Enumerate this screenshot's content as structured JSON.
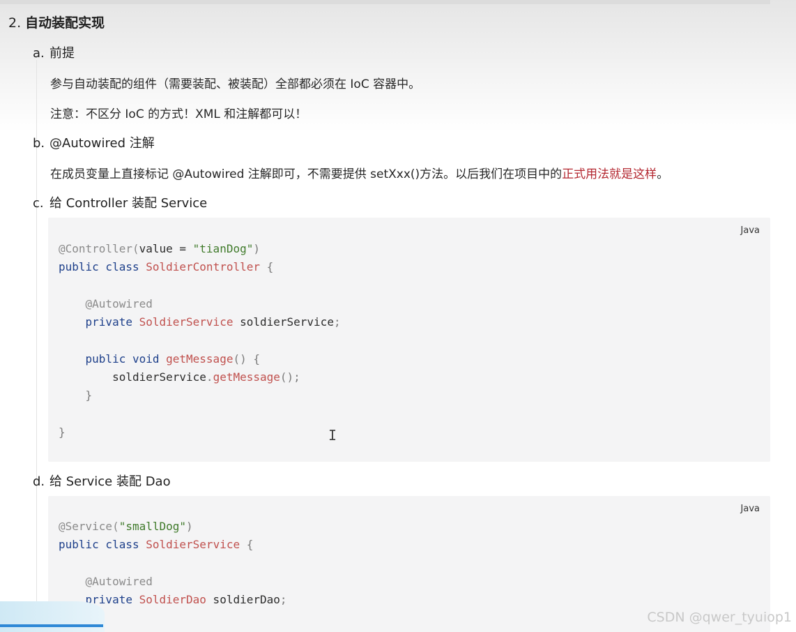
{
  "heading": {
    "number": "2.",
    "title": "自动装配实现"
  },
  "items": [
    {
      "marker": "a.",
      "title": "前提"
    },
    {
      "marker": "b.",
      "title": "@Autowired 注解"
    },
    {
      "marker": "c.",
      "title": "给 Controller 装配 Service"
    },
    {
      "marker": "d.",
      "title": "给 Service 装配 Dao"
    }
  ],
  "paragraphs": {
    "a1": "参与自动装配的组件（需要装配、被装配）全部都必须在 IoC 容器中。",
    "a2": "注意：不区分 IoC 的方式！XML 和注解都可以！",
    "b1_prefix": "在成员变量上直接标记 @Autowired 注解即可，不需要提供 setXxx()方法。以后我们在项目中的",
    "b1_highlight": "正式用法就是这样",
    "b1_suffix": "。"
  },
  "code_blocks": [
    {
      "language": "Java",
      "lines": {
        "l1_ann": "@Controller(",
        "l1_param": "value = ",
        "l1_str": "\"tianDog\"",
        "l1_end": ")",
        "l2_kw": "public class ",
        "l2_cls": "SoldierController",
        "l2_end": " {",
        "l4_ann": "@Autowired",
        "l5_kw": "private ",
        "l5_cls": "SoldierService",
        "l5_rest": " soldierService",
        "l5_end": ";",
        "l7_kw": "public void ",
        "l7_fn": "getMessage",
        "l7_end": "() {",
        "l8_obj": "soldierService",
        "l8_dot": ".",
        "l8_fn": "getMessage",
        "l8_end": "();",
        "l9_close": "}",
        "l11_close": "}"
      }
    },
    {
      "language": "Java",
      "lines": {
        "l1_ann": "@Service(",
        "l1_str": "\"smallDog\"",
        "l1_end": ")",
        "l2_kw": "public class ",
        "l2_cls": "SoldierService",
        "l2_end": " {",
        "l4_ann": "@Autowired",
        "l5_kw": "private ",
        "l5_cls": "SoldierDao",
        "l5_rest": " soldierDao",
        "l5_end": ";"
      }
    }
  ],
  "watermark": "CSDN @qwer_tyuiop1"
}
